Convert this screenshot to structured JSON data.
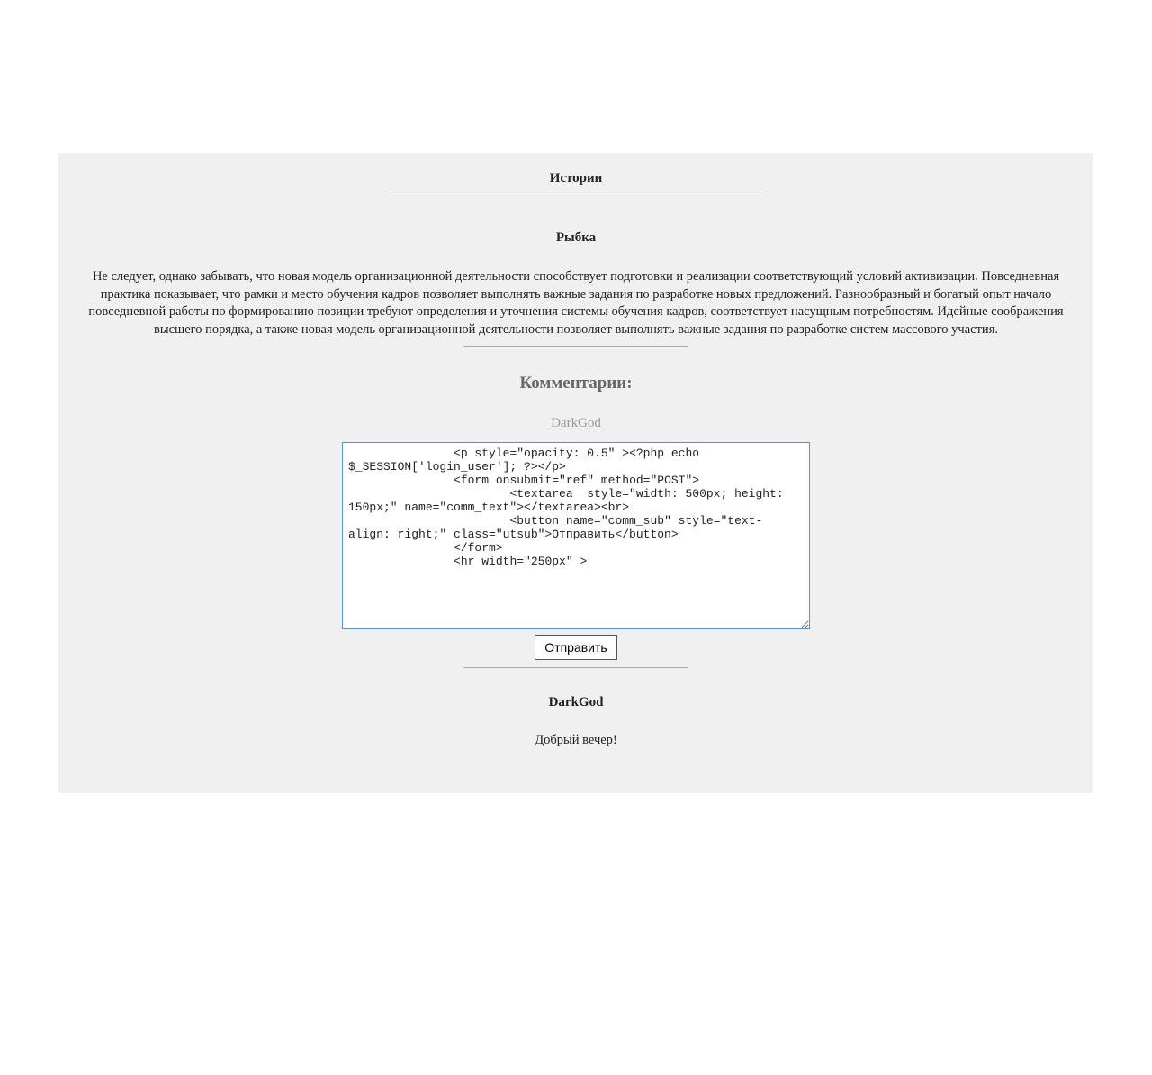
{
  "header": {
    "title": "Истории"
  },
  "story": {
    "title": "Рыбка",
    "body": "Не следует, однако забывать, что новая модель организационной деятельности способствует подготовки и реализации соответствующий условий активизации. Повседневная практика показывает, что рамки и место обучения кадров позволяет выполнять важные задания по разработке новых предложений. Разнообразный и богатый опыт начало повседневной работы по формированию позиции требуют определения и уточнения системы обучения кадров, соответствует насущным потребностям. Идейные соображения высшего порядка, а также новая модель организационной деятельности позволяет выполнять важные задания по разработке систем массового участия."
  },
  "comments": {
    "heading": "Комментарии:",
    "current_user": "DarkGod",
    "textarea_value": "               <p style=\"opacity: 0.5\" ><?php echo $_SESSION['login_user']; ?></p>\n               <form onsubmit=\"ref\" method=\"POST\">\n                       <textarea  style=\"width: 500px; height: 150px;\" name=\"comm_text\"></textarea><br>\n                       <button name=\"comm_sub\" style=\"text-align: right;\" class=\"utsub\">Отправить</button>\n               </form>\n               <hr width=\"250px\" >",
    "submit_label": "Отправить",
    "items": [
      {
        "author": "DarkGod",
        "text": "Добрый вечер!"
      }
    ]
  }
}
